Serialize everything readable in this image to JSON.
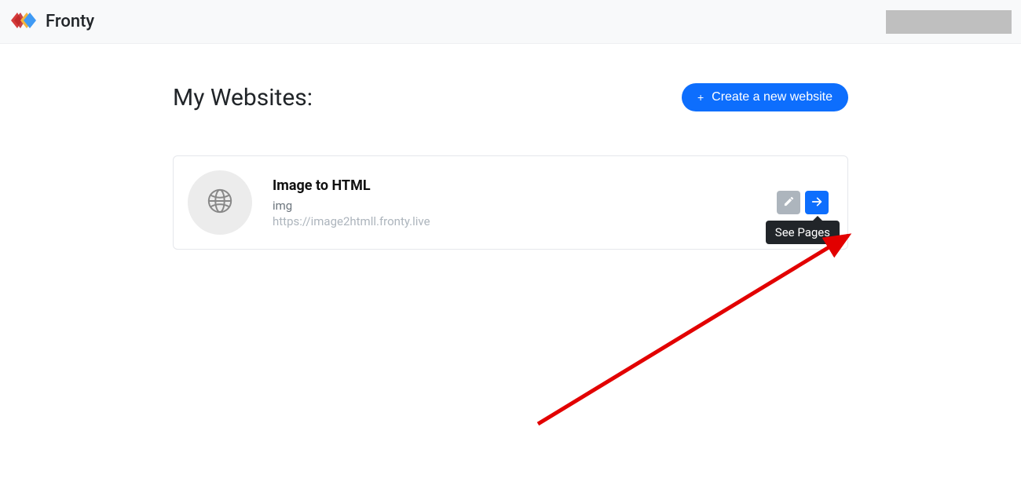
{
  "header": {
    "brand": "Fronty"
  },
  "page": {
    "title": "My Websites:",
    "create_label": "Create a new website"
  },
  "site": {
    "title": "Image to HTML",
    "subtitle": "img",
    "url": "https://image2htmll.fronty.live"
  },
  "tooltip": "See Pages"
}
